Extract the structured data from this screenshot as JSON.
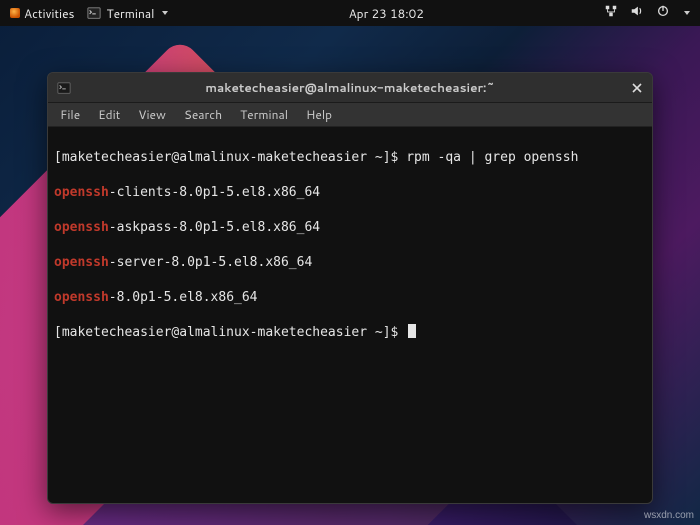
{
  "topbar": {
    "activities": "Activities",
    "app_name": "Terminal",
    "clock": "Apr 23  18:02"
  },
  "window": {
    "title": "maketecheasier@almalinux-maketecheasier:~"
  },
  "menubar": {
    "file": "File",
    "edit": "Edit",
    "view": "View",
    "search": "Search",
    "terminal": "Terminal",
    "help": "Help"
  },
  "terminal": {
    "prompt1_pre": "[maketecheasier@almalinux-maketecheasier ~]$ ",
    "cmd1": "rpm -qa | grep openssh",
    "lines": [
      {
        "match": "openssh",
        "rest": "-clients-8.0p1-5.el8.x86_64"
      },
      {
        "match": "openssh",
        "rest": "-askpass-8.0p1-5.el8.x86_64"
      },
      {
        "match": "openssh",
        "rest": "-server-8.0p1-5.el8.x86_64"
      },
      {
        "match": "openssh",
        "rest": "-8.0p1-5.el8.x86_64"
      }
    ],
    "prompt2": "[maketecheasier@almalinux-maketecheasier ~]$ "
  },
  "watermark": "wsxdn.com"
}
